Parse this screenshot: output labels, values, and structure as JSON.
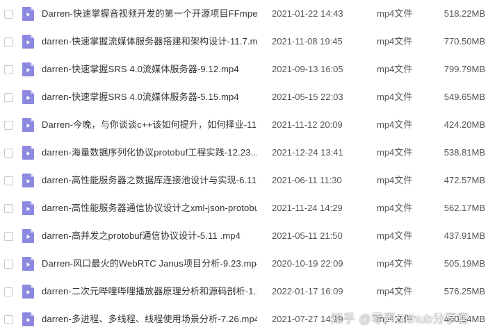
{
  "files": [
    {
      "name": "Darren-快速掌握音视频开发的第一个开源项目FFmpeg-...",
      "date": "2021-01-22 14:43",
      "type": "mp4文件",
      "size": "518.22MB"
    },
    {
      "name": "darren-快速掌握流媒体服务器搭建和架构设计-11.7.mp4",
      "date": "2021-11-08 19:45",
      "type": "mp4文件",
      "size": "770.50MB"
    },
    {
      "name": "darren-快速掌握SRS 4.0流媒体服务器-9.12.mp4",
      "date": "2021-09-13 16:05",
      "type": "mp4文件",
      "size": "799.79MB"
    },
    {
      "name": "darren-快速掌握SRS 4.0流媒体服务器-5.15.mp4",
      "date": "2021-05-15 22:03",
      "type": "mp4文件",
      "size": "549.65MB"
    },
    {
      "name": "Darren-今晚，与你谈谈c++该如何提升，如何择业-11.1...",
      "date": "2021-11-12 20:09",
      "type": "mp4文件",
      "size": "424.20MB"
    },
    {
      "name": "darren-海量数据序列化协议protobuf工程实践-12.23.....",
      "date": "2021-12-24 13:41",
      "type": "mp4文件",
      "size": "538.81MB"
    },
    {
      "name": "darren-高性能服务器之数据库连接池设计与实现-6.11.m...",
      "date": "2021-06-11 11:30",
      "type": "mp4文件",
      "size": "472.57MB"
    },
    {
      "name": "darren-高性能服务器通信协议设计之xml-json-protobu...",
      "date": "2021-11-24 14:29",
      "type": "mp4文件",
      "size": "562.17MB"
    },
    {
      "name": "darren-高并发之protobuf通信协议设计-5.11 .mp4",
      "date": "2021-05-11 21:50",
      "type": "mp4文件",
      "size": "437.91MB"
    },
    {
      "name": "Darren-风口最火的WebRTC Janus项目分析-9.23.mp4",
      "date": "2020-10-19 22:09",
      "type": "mp4文件",
      "size": "505.19MB"
    },
    {
      "name": "darren-二次元哔哩哔哩播放器原理分析和源码剖析-1.16....",
      "date": "2022-01-17 16:09",
      "type": "mp4文件",
      "size": "576.25MB"
    },
    {
      "name": "darren-多进程、多线程、线程使用场景分析-7.26.mp4",
      "date": "2021-07-27 14:19",
      "type": "mp4文件",
      "size": "400.54MB"
    }
  ],
  "icons": {
    "checkbox": "checkbox-icon",
    "file": "video-file-icon"
  },
  "colors": {
    "file_icon": "#8c88e0",
    "file_icon_fold": "#c9c6f5"
  },
  "watermark": "知乎 @零声Github分享官"
}
